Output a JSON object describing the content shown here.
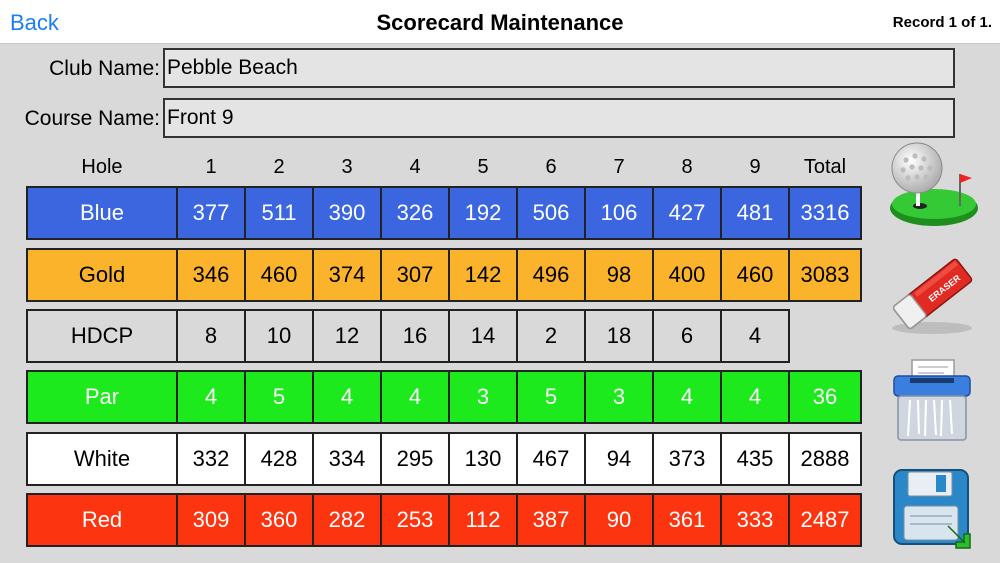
{
  "header": {
    "back_label": "Back",
    "title": "Scorecard Maintenance",
    "record_status": "Record 1 of 1."
  },
  "form": {
    "club_label": "Club Name:",
    "club_value": "Pebble Beach",
    "course_label": "Course Name:",
    "course_value": "Front 9"
  },
  "scorecard": {
    "columns": [
      "Hole",
      "1",
      "2",
      "3",
      "4",
      "5",
      "6",
      "7",
      "8",
      "9",
      "Total"
    ],
    "rows": [
      {
        "label": "Blue",
        "values": [
          "377",
          "511",
          "390",
          "326",
          "192",
          "506",
          "106",
          "427",
          "481"
        ],
        "total": "3316",
        "bg": "#3b66e0",
        "fg": "#ffffff"
      },
      {
        "label": "Gold",
        "values": [
          "346",
          "460",
          "374",
          "307",
          "142",
          "496",
          "98",
          "400",
          "460"
        ],
        "total": "3083",
        "bg": "#fbb32c",
        "fg": "#000000"
      },
      {
        "label": "HDCP",
        "values": [
          "8",
          "10",
          "12",
          "16",
          "14",
          "2",
          "18",
          "6",
          "4"
        ],
        "total": null,
        "bg": "#d9d9d9",
        "fg": "#000000"
      },
      {
        "label": "Par",
        "values": [
          "4",
          "5",
          "4",
          "4",
          "3",
          "5",
          "3",
          "4",
          "4"
        ],
        "total": "36",
        "bg": "#1dea1d",
        "fg": "#ffffff"
      },
      {
        "label": "White",
        "values": [
          "332",
          "428",
          "334",
          "295",
          "130",
          "467",
          "94",
          "373",
          "435"
        ],
        "total": "2888",
        "bg": "#ffffff",
        "fg": "#000000"
      },
      {
        "label": "Red",
        "values": [
          "309",
          "360",
          "282",
          "253",
          "112",
          "387",
          "90",
          "361",
          "333"
        ],
        "total": "2487",
        "bg": "#fc3410",
        "fg": "#ffffff"
      }
    ]
  },
  "sidebar": {
    "icons": [
      "golf-ball-icon",
      "eraser-icon",
      "shredder-icon",
      "save-disk-icon"
    ],
    "eraser_text": "ERASER"
  },
  "colors": {
    "link": "#1a7ef7",
    "background": "#d9d9d9"
  }
}
